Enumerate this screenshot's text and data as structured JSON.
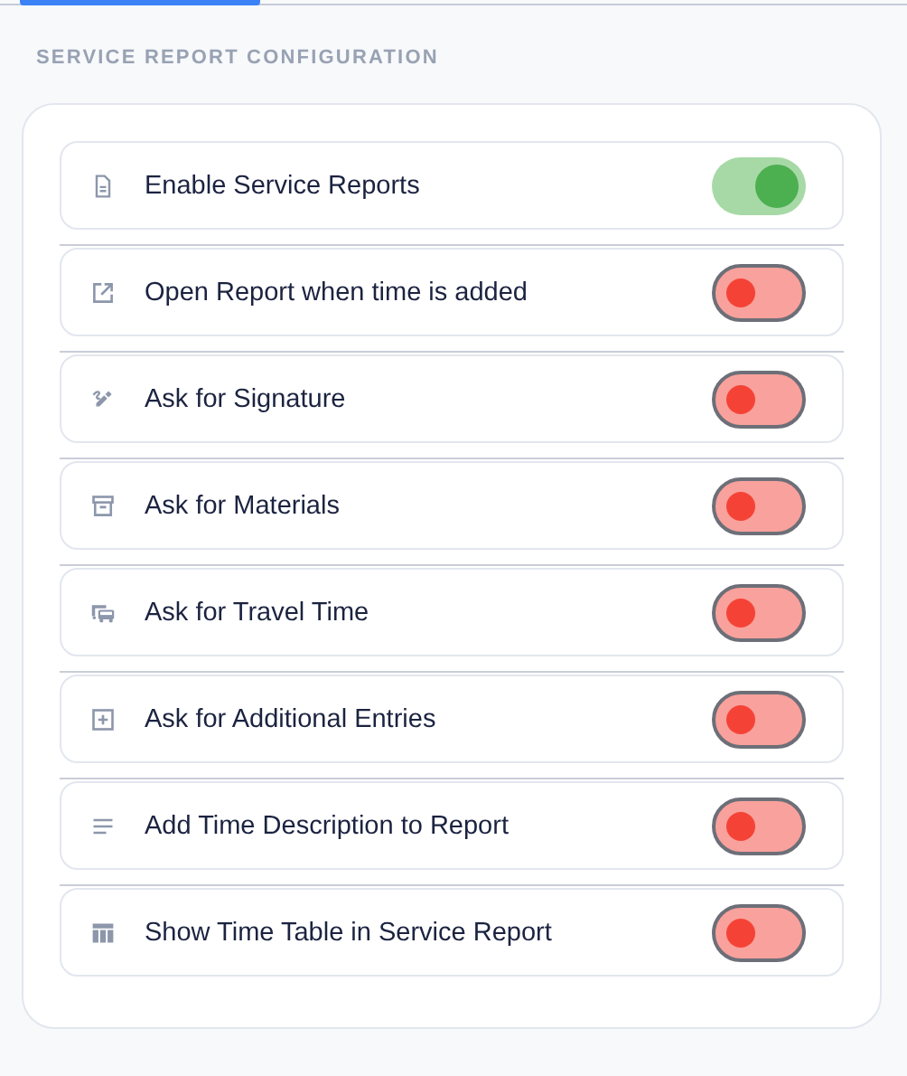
{
  "section_title": "SERVICE REPORT CONFIGURATION",
  "settings": [
    {
      "label": "Enable Service Reports",
      "on": true
    },
    {
      "label": "Open Report when time is added",
      "on": false
    },
    {
      "label": "Ask for Signature",
      "on": false
    },
    {
      "label": "Ask for Materials",
      "on": false
    },
    {
      "label": "Ask for Travel Time",
      "on": false
    },
    {
      "label": "Ask for Additional Entries",
      "on": false
    },
    {
      "label": "Add Time Description to Report",
      "on": false
    },
    {
      "label": "Show Time Table in Service Report",
      "on": false
    }
  ]
}
